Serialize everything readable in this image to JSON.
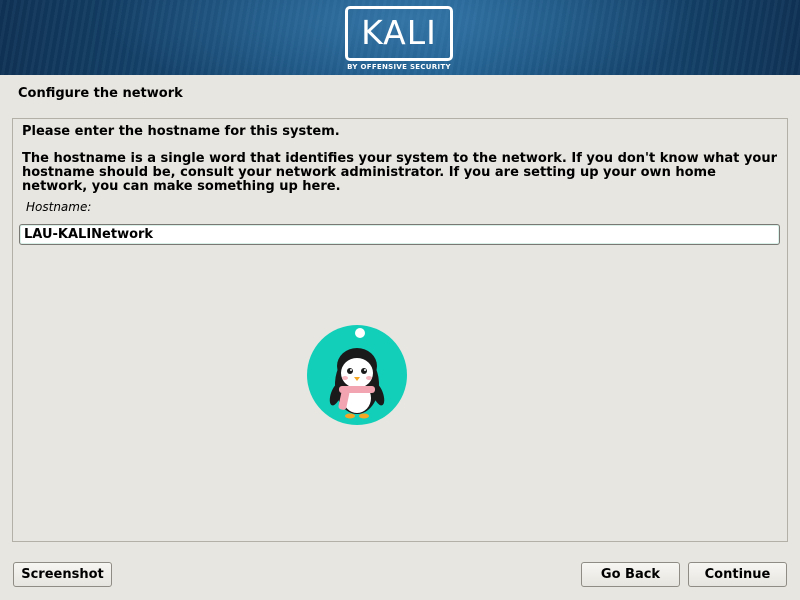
{
  "header": {
    "logo_text": "KALI",
    "logo_subtext": "BY OFFENSIVE SECURITY"
  },
  "step": {
    "title": "Configure the network"
  },
  "main": {
    "prompt": "Please enter the hostname for this system.",
    "description": "The hostname is a single word that identifies your system to the network. If you don't know what your hostname should be, consult your network administrator. If you are setting up your own home network, you can make something up here.",
    "field_label": "Hostname:",
    "hostname_value": "LAU-KALINetwork"
  },
  "mascot": {
    "icon": "penguin-mascot-icon",
    "circle_color": "#12cfb9",
    "scarf_color": "#f2a4b0"
  },
  "buttons": {
    "screenshot": "Screenshot",
    "back": "Go Back",
    "continue": "Continue"
  }
}
